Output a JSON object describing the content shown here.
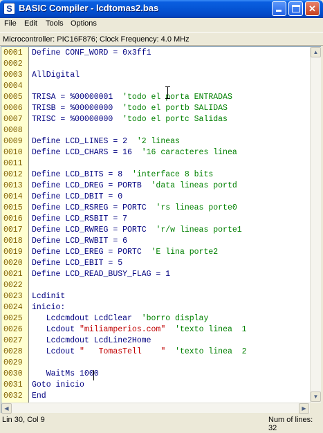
{
  "window": {
    "title": "BASIC Compiler - lcdtomas2.bas",
    "app_icon": "S",
    "buttons": [
      "minimize",
      "maximize",
      "close"
    ]
  },
  "menu": [
    "File",
    "Edit",
    "Tools",
    "Options"
  ],
  "info": "Microcontroller: PIC16F876;  Clock Frequency: 4.0 MHz",
  "lines": [
    {
      "n": "0001",
      "code": "Define CONF_WORD = 0x3ff1",
      "comment": ""
    },
    {
      "n": "0002",
      "code": "",
      "comment": ""
    },
    {
      "n": "0003",
      "code": "AllDigital",
      "comment": ""
    },
    {
      "n": "0004",
      "code": "",
      "comment": ""
    },
    {
      "n": "0005",
      "code": "TRISA = %00000001  ",
      "comment": "'todo el porta ENTRADAS"
    },
    {
      "n": "0006",
      "code": "TRISB = %00000000  ",
      "comment": "'todo el portb SALIDAS"
    },
    {
      "n": "0007",
      "code": "TRISC = %00000000  ",
      "comment": "'todo el portc Salidas"
    },
    {
      "n": "0008",
      "code": "",
      "comment": ""
    },
    {
      "n": "0009",
      "code": "Define LCD_LINES = 2  ",
      "comment": "'2 lineas"
    },
    {
      "n": "0010",
      "code": "Define LCD_CHARS = 16  ",
      "comment": "'16 caracteres linea"
    },
    {
      "n": "0011",
      "code": "",
      "comment": ""
    },
    {
      "n": "0012",
      "code": "Define LCD_BITS = 8  ",
      "comment": "'interface 8 bits"
    },
    {
      "n": "0013",
      "code": "Define LCD_DREG = PORTB  ",
      "comment": "'data lineas portd"
    },
    {
      "n": "0014",
      "code": "Define LCD_DBIT = 0",
      "comment": ""
    },
    {
      "n": "0015",
      "code": "Define LCD_RSREG = PORTC  ",
      "comment": "'rs lineas porte0"
    },
    {
      "n": "0016",
      "code": "Define LCD_RSBIT = 7",
      "comment": ""
    },
    {
      "n": "0017",
      "code": "Define LCD_RWREG = PORTC  ",
      "comment": "'r/w lineas porte1"
    },
    {
      "n": "0018",
      "code": "Define LCD_RWBIT = 6",
      "comment": ""
    },
    {
      "n": "0019",
      "code": "Define LCD_EREG = PORTC  ",
      "comment": "'E lina porte2"
    },
    {
      "n": "0020",
      "code": "Define LCD_EBIT = 5",
      "comment": ""
    },
    {
      "n": "0021",
      "code": "Define LCD_READ_BUSY_FLAG = 1",
      "comment": ""
    },
    {
      "n": "0022",
      "code": "",
      "comment": ""
    },
    {
      "n": "0023",
      "code": "Lcdinit",
      "comment": ""
    },
    {
      "n": "0024",
      "code": "inicio:",
      "comment": ""
    },
    {
      "n": "0025",
      "code": "   Lcdcmdout LcdClear  ",
      "comment": "'borro display"
    },
    {
      "n": "0026",
      "code": "   Lcdout ",
      "str": "\"miliamperios.com\"",
      "after": "  ",
      "comment": "'texto linea  1"
    },
    {
      "n": "0027",
      "code": "   Lcdcmdout LcdLine2Home",
      "comment": ""
    },
    {
      "n": "0028",
      "code": "   Lcdout ",
      "str": "\"   TomasTell    \"",
      "after": "  ",
      "comment": "'texto linea  2"
    },
    {
      "n": "0029",
      "code": "",
      "comment": ""
    },
    {
      "n": "0030",
      "code": "   WaitMs 1000",
      "comment": ""
    },
    {
      "n": "0031",
      "code": "Goto inicio",
      "comment": ""
    },
    {
      "n": "0032",
      "code": "End",
      "comment": ""
    }
  ],
  "status": {
    "position": "Lin 30, Col 9",
    "lines": "Num of lines: 32"
  },
  "colors": {
    "code": "#000080",
    "comment": "#008000",
    "string": "#c00000",
    "gutter_bg": "#ffffd0",
    "line_number": "#806000"
  }
}
